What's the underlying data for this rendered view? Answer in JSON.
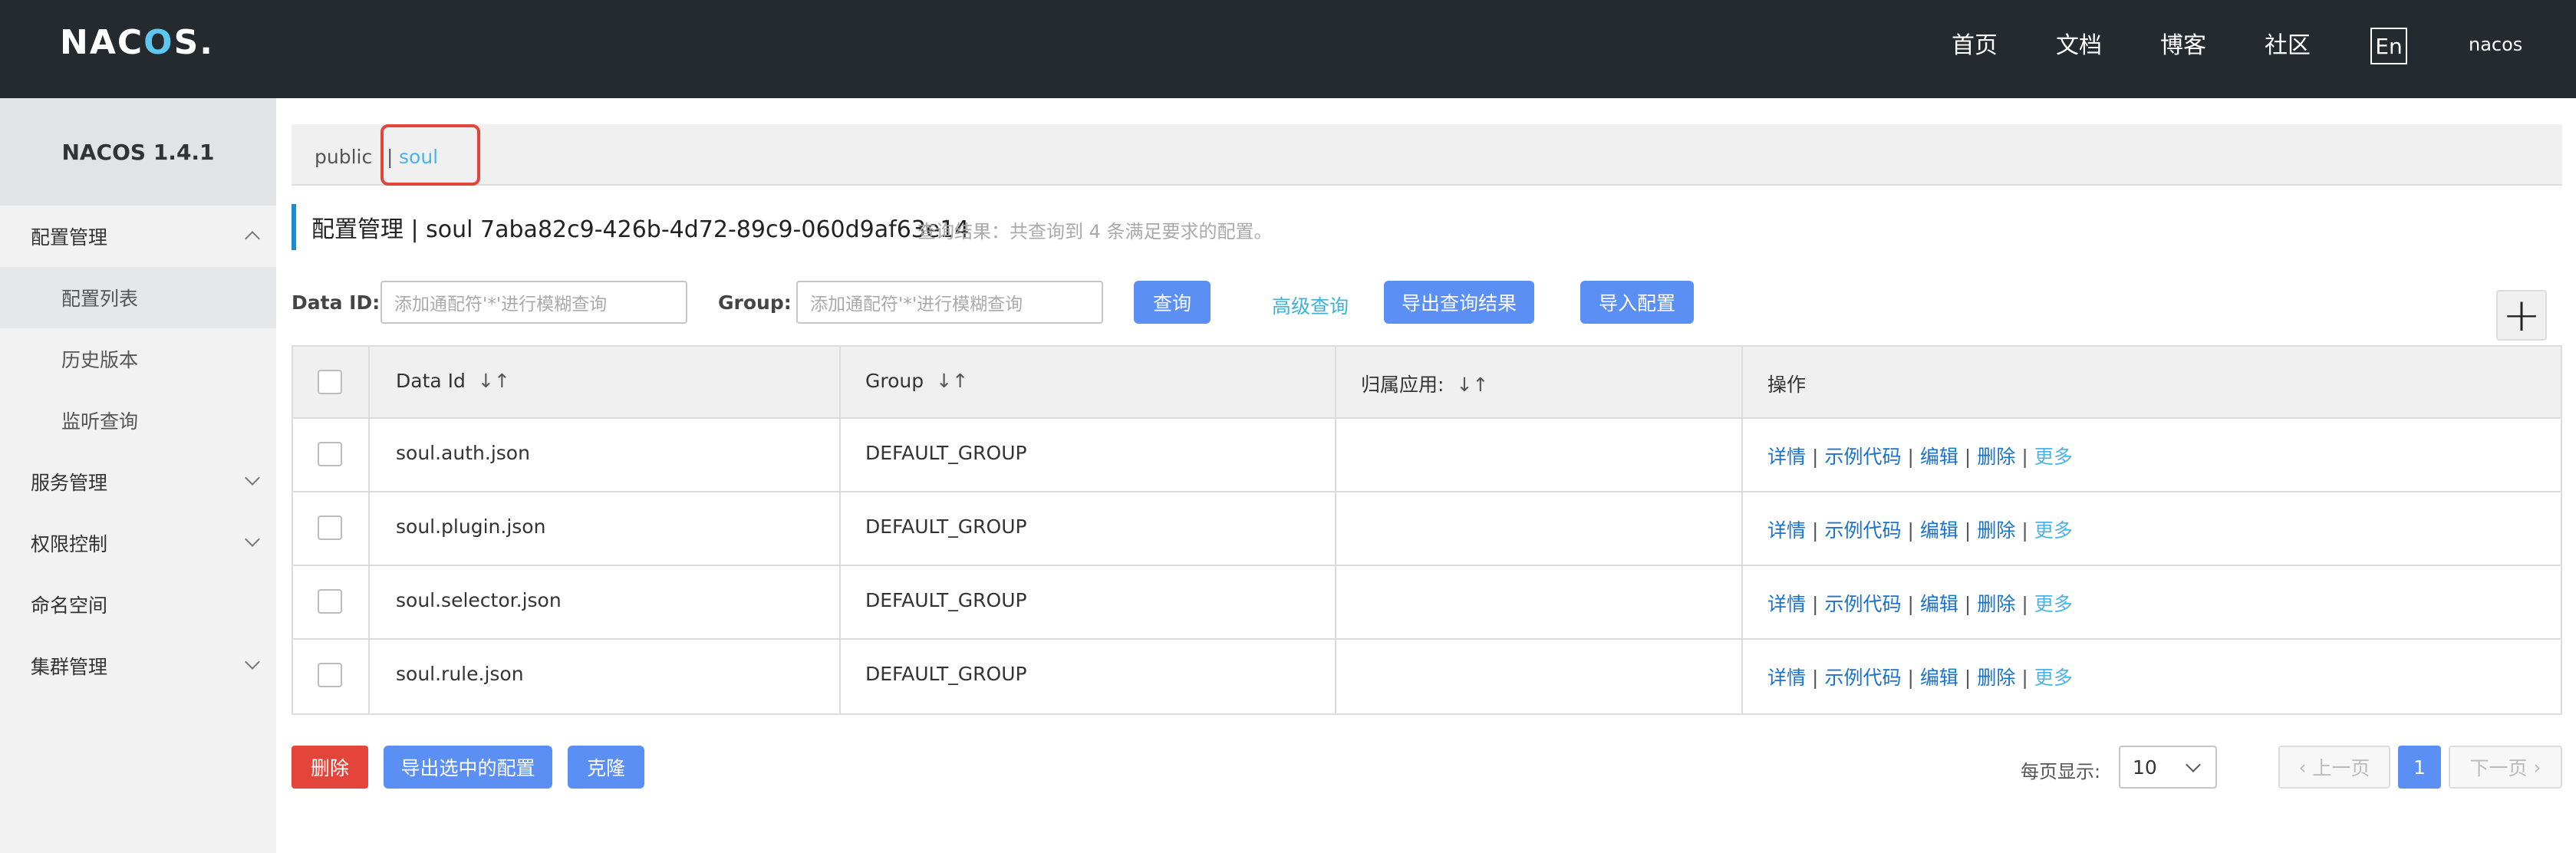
{
  "header": {
    "logo": "NACOS.",
    "nav": [
      "首页",
      "文档",
      "博客",
      "社区"
    ],
    "lang": "En",
    "user": "nacos"
  },
  "sidebar": {
    "version": "NACOS 1.4.1",
    "items": [
      {
        "label": "配置管理",
        "expanded": true
      },
      {
        "label": "配置列表",
        "sub": true,
        "active": true
      },
      {
        "label": "历史版本",
        "sub": true
      },
      {
        "label": "监听查询",
        "sub": true
      },
      {
        "label": "服务管理",
        "expanded": false
      },
      {
        "label": "权限控制",
        "expanded": false
      },
      {
        "label": "命名空间"
      },
      {
        "label": "集群管理",
        "expanded": false
      }
    ]
  },
  "namespace": {
    "public": "public",
    "separator": "|",
    "current": "soul"
  },
  "page": {
    "title": "配置管理  |  soul  7aba82c9-426b-4d72-89c9-060d9af63e14",
    "hint": "查询结果：共查询到 4 条满足要求的配置。"
  },
  "search": {
    "dataid_label": "Data ID:",
    "dataid_placeholder": "添加通配符'*'进行模糊查询",
    "group_label": "Group:",
    "group_placeholder": "添加通配符'*'进行模糊查询",
    "query": "查询",
    "advanced": "高级查询",
    "export_results": "导出查询结果",
    "import": "导入配置",
    "add": "+"
  },
  "table": {
    "headers": {
      "dataid": "Data Id",
      "group": "Group",
      "app": "归属应用:",
      "ops": "操作",
      "sort_icon": "↓↑"
    },
    "rows": [
      {
        "dataid": "soul.auth.json",
        "group": "DEFAULT_GROUP",
        "app": ""
      },
      {
        "dataid": "soul.plugin.json",
        "group": "DEFAULT_GROUP",
        "app": ""
      },
      {
        "dataid": "soul.selector.json",
        "group": "DEFAULT_GROUP",
        "app": ""
      },
      {
        "dataid": "soul.rule.json",
        "group": "DEFAULT_GROUP",
        "app": ""
      }
    ],
    "ops": {
      "detail": "详情",
      "sample": "示例代码",
      "edit": "编辑",
      "delete": "删除",
      "more": "更多"
    }
  },
  "bottom": {
    "delete": "删除",
    "export_selected": "导出选中的配置",
    "clone": "克隆",
    "page_size_label": "每页显示:",
    "page_size": "10",
    "prev": "上一页",
    "next": "下一页",
    "current_page": "1"
  }
}
